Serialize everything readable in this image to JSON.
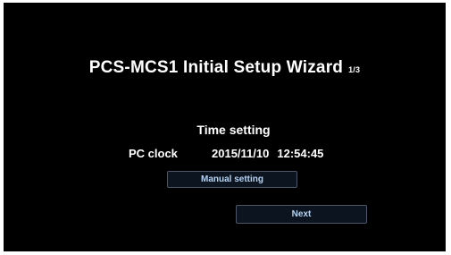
{
  "wizard": {
    "title": "PCS-MCS1 Initial Setup Wizard",
    "step": "1/3"
  },
  "time_setting": {
    "heading": "Time setting",
    "clock_label": "PC clock",
    "date": "2015/11/10",
    "time": "12:54:45"
  },
  "buttons": {
    "manual_setting": "Manual setting",
    "next": "Next"
  },
  "colors": {
    "background": "#000000",
    "text": "#ffffff",
    "button_text": "#b7d4f4",
    "button_bg": "#0c1420",
    "button_border": "#4d5566"
  }
}
